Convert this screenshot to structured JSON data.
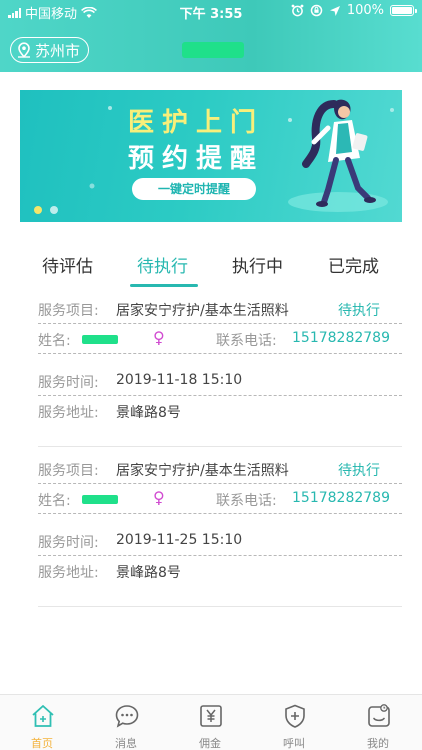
{
  "status_bar": {
    "carrier": "中国移动",
    "time": "下午 3:55",
    "battery": "100%"
  },
  "nav": {
    "city": "苏州市"
  },
  "banner": {
    "title_line1": "医护上门",
    "title_line2": "预约提醒",
    "button": "一键定时提醒",
    "page_index": 0,
    "page_count": 2
  },
  "tabs": [
    {
      "label": "待评估"
    },
    {
      "label": "待执行"
    },
    {
      "label": "执行中"
    },
    {
      "label": "已完成"
    }
  ],
  "orders": [
    {
      "service_label": "服务项目:",
      "service": "居家安宁疗护/基本生活照料",
      "status": "待执行",
      "name_label": "姓名:",
      "gender": "♀",
      "phone_label": "联系电话:",
      "phone": "15178282789",
      "time_label": "服务时间:",
      "time": "2019-11-18 15:10",
      "address_label": "服务地址:",
      "address": "景峰路8号"
    },
    {
      "service_label": "服务项目:",
      "service": "居家安宁疗护/基本生活照料",
      "status": "待执行",
      "name_label": "姓名:",
      "gender": "♀",
      "phone_label": "联系电话:",
      "phone": "15178282789",
      "time_label": "服务时间:",
      "time": "2019-11-25 15:10",
      "address_label": "服务地址:",
      "address": "景峰路8号"
    }
  ],
  "tabbar": [
    {
      "label": "首页",
      "icon": "home-icon"
    },
    {
      "label": "消息",
      "icon": "message-icon"
    },
    {
      "label": "佣金",
      "icon": "commission-icon"
    },
    {
      "label": "呼叫",
      "icon": "call-shield-icon"
    },
    {
      "label": "我的",
      "icon": "profile-icon"
    }
  ],
  "colors": {
    "accent": "#28b8b0",
    "tab_active": "#f3b33d",
    "banner_yellow": "#f8ef7a",
    "female": "#d14bd1"
  }
}
